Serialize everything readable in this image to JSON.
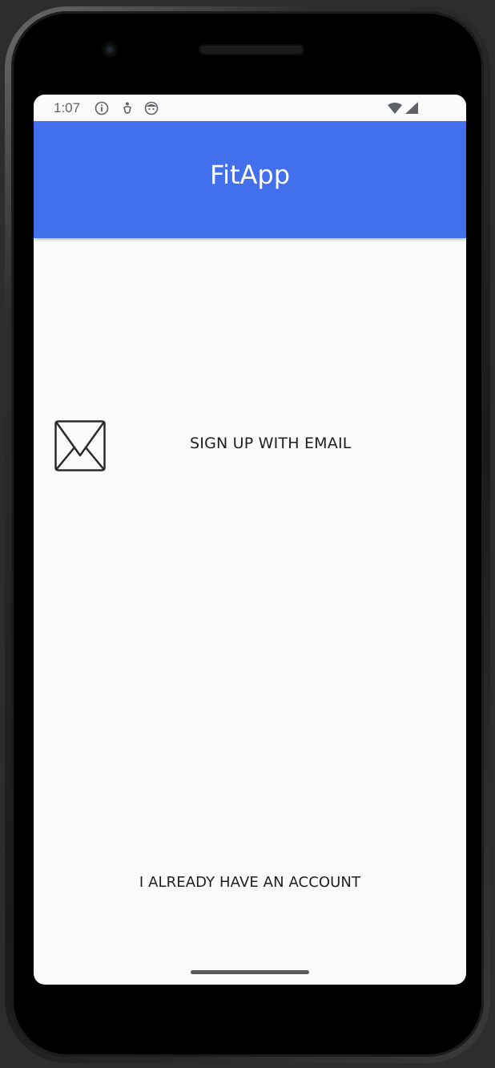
{
  "status_bar": {
    "time": "1:07",
    "icons": [
      "info-icon",
      "accessibility-icon",
      "face-icon",
      "wifi-icon",
      "cellular-signal-icon"
    ]
  },
  "app_bar": {
    "title": "FitApp",
    "color": "#4270ed"
  },
  "main": {
    "signup_icon": "mail-icon",
    "signup_label": "SIGN UP WITH EMAIL",
    "login_label": "I ALREADY HAVE AN ACCOUNT"
  },
  "colors": {
    "screen_background": "#fafafa",
    "text": "#1f1f1f"
  }
}
